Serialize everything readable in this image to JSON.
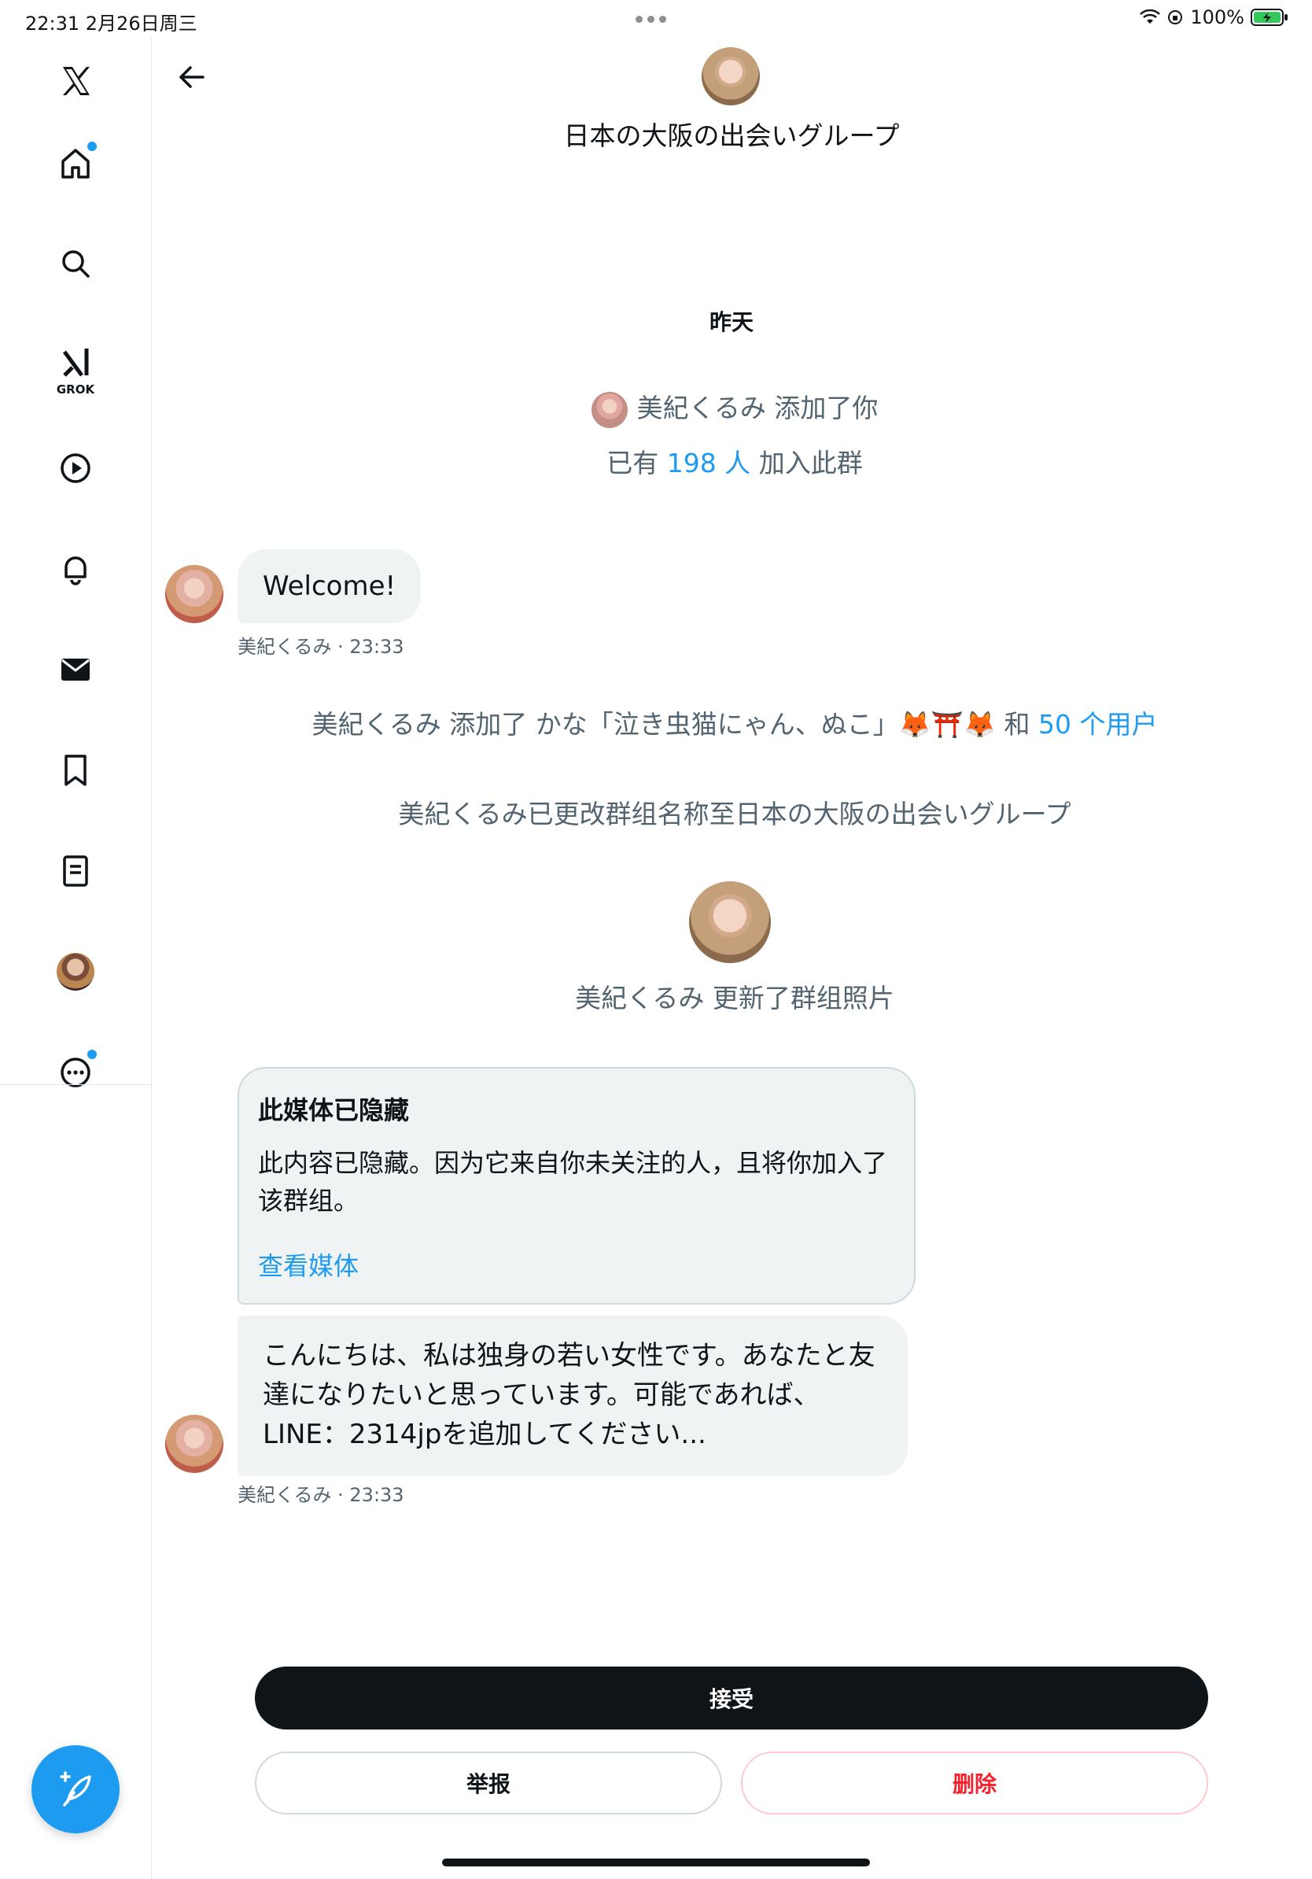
{
  "status_bar": {
    "time": "22:31  2月26日周三",
    "battery": "100%"
  },
  "sidebar": {
    "items": [
      {
        "icon": "x-logo-icon"
      },
      {
        "icon": "home-icon",
        "has_badge": true
      },
      {
        "icon": "search-icon"
      },
      {
        "icon": "grok-icon",
        "label": "GROK"
      },
      {
        "icon": "video-icon"
      },
      {
        "icon": "notifications-icon"
      },
      {
        "icon": "messages-icon"
      },
      {
        "icon": "bookmark-icon"
      },
      {
        "icon": "lists-icon"
      },
      {
        "icon": "profile-avatar"
      },
      {
        "icon": "more-icon",
        "has_badge": true
      }
    ],
    "compose_icon": "compose-icon"
  },
  "header": {
    "title": "日本の大阪の出会いグループ"
  },
  "conversation": {
    "day_label": "昨天",
    "added_you": "美紀くるみ 添加了你",
    "members_prefix": "已有 ",
    "members_link": "198 人",
    "members_suffix": " 加入此群",
    "welcome_message": "Welcome!",
    "welcome_meta": "美紀くるみ · 23:33",
    "added_users_prefix": "美紀くるみ 添加了 かな「泣き虫猫にゃん、ぬこ」🦊⛩️🦊 和 ",
    "added_users_link": "50 个用户",
    "renamed": "美紀くるみ已更改群组名称至日本の大阪の出会いグループ",
    "photo_updated": "美紀くるみ 更新了群组照片",
    "hidden_media": {
      "title": "此媒体已隐藏",
      "body": "此内容已隐藏。因为它来自你未关注的人，且将你加入了该群组。",
      "link": "查看媒体"
    },
    "long_message": "こんにちは、私は独身の若い女性です。あなたと友達になりたいと思っています。可能であれば、LINE：2314jpを追加してください...",
    "long_meta": "美紀くるみ · 23:33"
  },
  "actions": {
    "accept": "接受",
    "report": "举报",
    "delete": "删除"
  },
  "colors": {
    "accent": "#1d9bf0",
    "danger": "#f4212e",
    "primary_button": "#0f1419",
    "bubble": "#eff3f4"
  }
}
